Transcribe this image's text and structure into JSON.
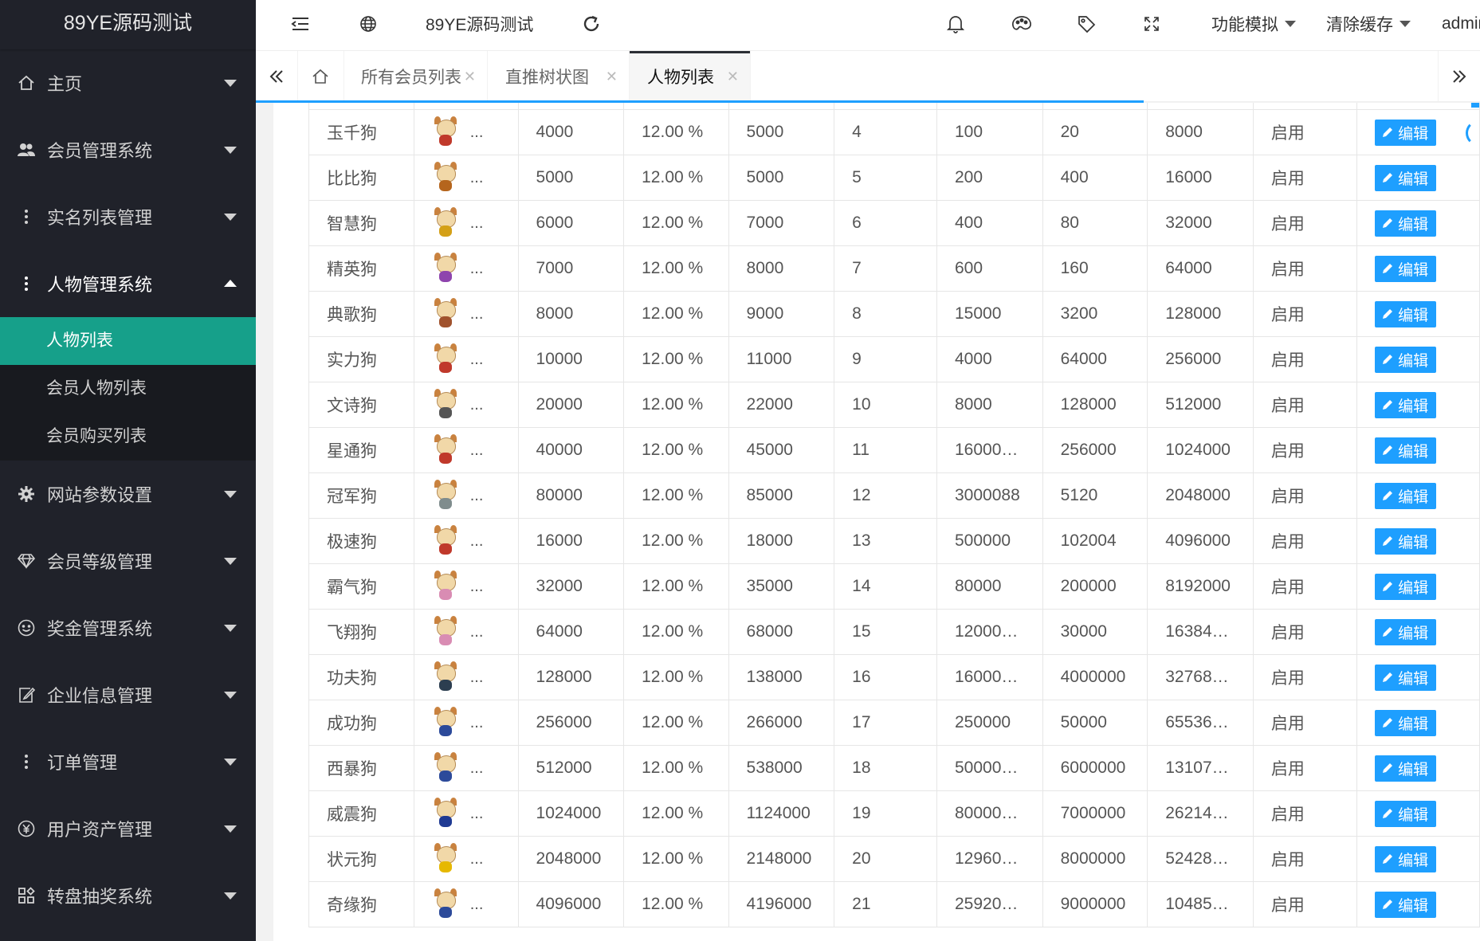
{
  "app": {
    "logo": "89YE源码测试"
  },
  "sidebar": {
    "items": [
      {
        "label": "主页",
        "icon": "home-icon"
      },
      {
        "label": "会员管理系统",
        "icon": "users-icon"
      },
      {
        "label": "实名列表管理",
        "icon": "dots-icon"
      },
      {
        "label": "人物管理系统",
        "icon": "dots-icon"
      },
      {
        "label": "网站参数设置",
        "icon": "gear-icon"
      },
      {
        "label": "会员等级管理",
        "icon": "diamond-icon"
      },
      {
        "label": "奖金管理系统",
        "icon": "smile-icon"
      },
      {
        "label": "企业信息管理",
        "icon": "edit-icon"
      },
      {
        "label": "订单管理",
        "icon": "dots-icon"
      },
      {
        "label": "用户资产管理",
        "icon": "yen-icon"
      },
      {
        "label": "转盘抽奖系统",
        "icon": "apps-icon"
      }
    ],
    "submenu": [
      "人物列表",
      "会员人物列表",
      "会员购买列表"
    ]
  },
  "header": {
    "title": "89YE源码测试",
    "menu1": "功能模拟",
    "menu2": "清除缓存",
    "user": "admin"
  },
  "tabs": [
    {
      "label": "所有会员列表"
    },
    {
      "label": "直推树状图"
    },
    {
      "label": "人物列表"
    }
  ],
  "table": {
    "edit_label": "编辑",
    "rows": [
      [
        "玉千狗",
        "4000",
        "12.00 %",
        "5000",
        "4",
        "100",
        "20",
        "8000",
        "启用"
      ],
      [
        "比比狗",
        "5000",
        "12.00 %",
        "5000",
        "5",
        "200",
        "400",
        "16000",
        "启用"
      ],
      [
        "智慧狗",
        "6000",
        "12.00 %",
        "7000",
        "6",
        "400",
        "80",
        "32000",
        "启用"
      ],
      [
        "精英狗",
        "7000",
        "12.00 %",
        "8000",
        "7",
        "600",
        "160",
        "64000",
        "启用"
      ],
      [
        "典歌狗",
        "8000",
        "12.00 %",
        "9000",
        "8",
        "15000",
        "3200",
        "128000",
        "启用"
      ],
      [
        "实力狗",
        "10000",
        "12.00 %",
        "11000",
        "9",
        "4000",
        "64000",
        "256000",
        "启用"
      ],
      [
        "文诗狗",
        "20000",
        "12.00 %",
        "22000",
        "10",
        "8000",
        "128000",
        "512000",
        "启用"
      ],
      [
        "星通狗",
        "40000",
        "12.00 %",
        "45000",
        "11",
        "16000…",
        "256000",
        "1024000",
        "启用"
      ],
      [
        "冠军狗",
        "80000",
        "12.00 %",
        "85000",
        "12",
        "3000088",
        "5120",
        "2048000",
        "启用"
      ],
      [
        "极速狗",
        "16000",
        "12.00 %",
        "18000",
        "13",
        "500000",
        "102004",
        "4096000",
        "启用"
      ],
      [
        "霸气狗",
        "32000",
        "12.00 %",
        "35000",
        "14",
        "80000",
        "200000",
        "8192000",
        "启用"
      ],
      [
        "飞翔狗",
        "64000",
        "12.00 %",
        "68000",
        "15",
        "12000…",
        "30000",
        "16384…",
        "启用"
      ],
      [
        "功夫狗",
        "128000",
        "12.00 %",
        "138000",
        "16",
        "16000…",
        "4000000",
        "32768…",
        "启用"
      ],
      [
        "成功狗",
        "256000",
        "12.00 %",
        "266000",
        "17",
        "250000",
        "50000",
        "65536…",
        "启用"
      ],
      [
        "西暴狗",
        "512000",
        "12.00 %",
        "538000",
        "18",
        "50000…",
        "6000000",
        "13107…",
        "启用"
      ],
      [
        "威震狗",
        "1024000",
        "12.00 %",
        "1124000",
        "19",
        "80000…",
        "7000000",
        "26214…",
        "启用"
      ],
      [
        "状元狗",
        "2048000",
        "12.00 %",
        "2148000",
        "20",
        "12960…",
        "8000000",
        "52428…",
        "启用"
      ],
      [
        "奇缘狗",
        "4096000",
        "12.00 %",
        "4196000",
        "21",
        "25920…",
        "9000000",
        "10485…",
        "启用"
      ]
    ],
    "avatar_colors": [
      "#c0392b",
      "#b5651d",
      "#d4a017",
      "#8e44ad",
      "#a0522d",
      "#c0392b",
      "#555555",
      "#c0392b",
      "#7f8c8d",
      "#c0392b",
      "#d98cb3",
      "#d98cb3",
      "#2c3e50",
      "#2c4a9a",
      "#2c4a9a",
      "#1f3a93",
      "#e6b800",
      "#2c4a9a"
    ]
  },
  "colors": {
    "accent": "#16a08a",
    "primary": "#1e9fff",
    "sidebar": "#20222a"
  }
}
